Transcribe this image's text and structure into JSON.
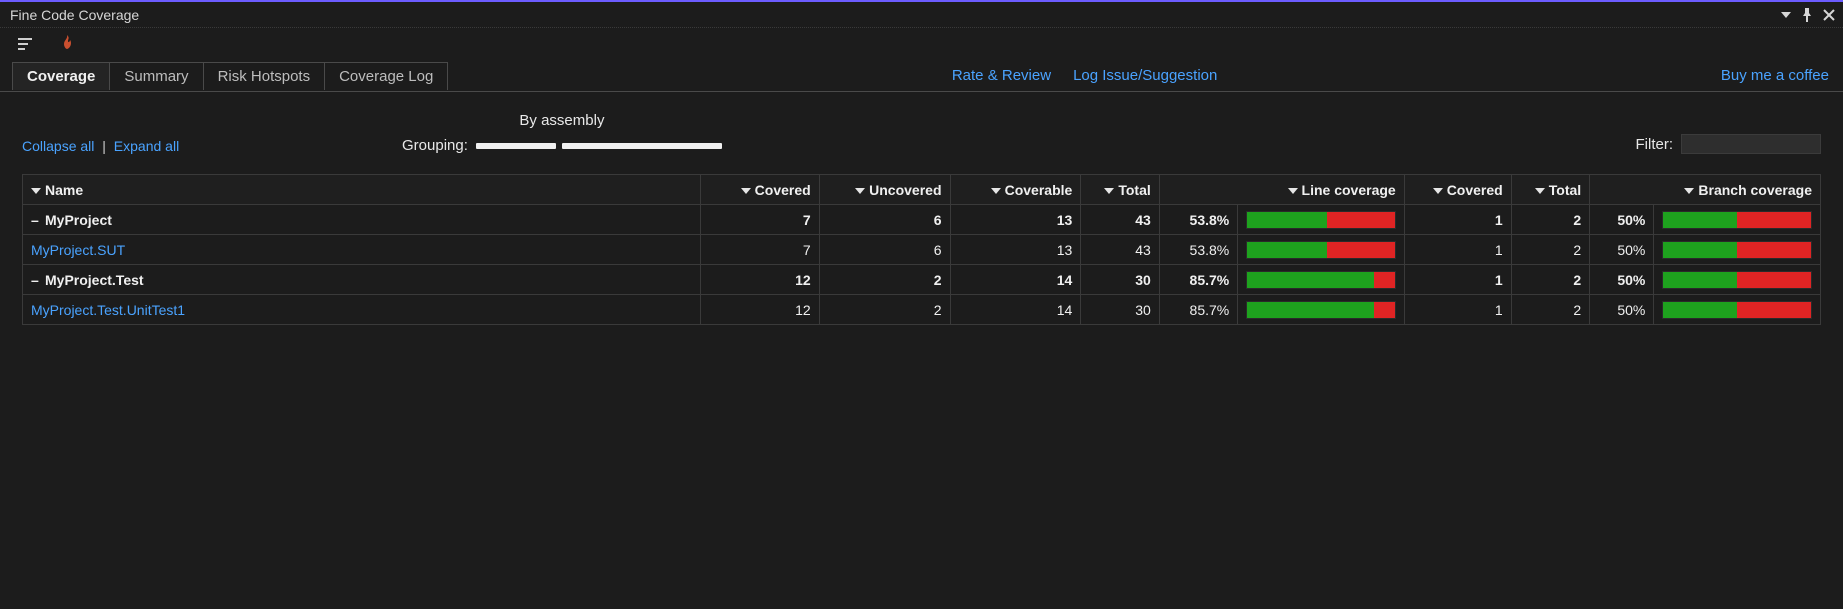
{
  "window": {
    "title": "Fine Code Coverage"
  },
  "toolbar_icons": {
    "coverage_view": "coverage-icon",
    "fire": "flame-icon"
  },
  "tabs": [
    {
      "label": "Coverage",
      "active": true
    },
    {
      "label": "Summary"
    },
    {
      "label": "Risk Hotspots"
    },
    {
      "label": "Coverage Log"
    }
  ],
  "links": {
    "rate_review": "Rate & Review",
    "log_issue": "Log Issue/Suggestion",
    "coffee": "Buy me a coffee"
  },
  "controls": {
    "collapse_all": "Collapse all",
    "expand_all": "Expand all",
    "grouping_label": "Grouping:",
    "grouping_title": "By assembly",
    "filter_label": "Filter:",
    "filter_value": ""
  },
  "columns": {
    "name": "Name",
    "covered": "Covered",
    "uncovered": "Uncovered",
    "coverable": "Coverable",
    "total": "Total",
    "line_coverage": "Line coverage",
    "b_covered": "Covered",
    "b_total": "Total",
    "branch_coverage": "Branch coverage"
  },
  "rows": [
    {
      "type": "group",
      "name": "MyProject",
      "covered": "7",
      "uncovered": "6",
      "coverable": "13",
      "total": "43",
      "line_pct": "53.8%",
      "line_val": 53.8,
      "b_covered": "1",
      "b_total": "2",
      "branch_pct": "50%",
      "branch_val": 50
    },
    {
      "type": "child",
      "name": "MyProject.SUT",
      "covered": "7",
      "uncovered": "6",
      "coverable": "13",
      "total": "43",
      "line_pct": "53.8%",
      "line_val": 53.8,
      "b_covered": "1",
      "b_total": "2",
      "branch_pct": "50%",
      "branch_val": 50
    },
    {
      "type": "group",
      "name": "MyProject.Test",
      "covered": "12",
      "uncovered": "2",
      "coverable": "14",
      "total": "30",
      "line_pct": "85.7%",
      "line_val": 85.7,
      "b_covered": "1",
      "b_total": "2",
      "branch_pct": "50%",
      "branch_val": 50
    },
    {
      "type": "child",
      "name": "MyProject.Test.UnitTest1",
      "covered": "12",
      "uncovered": "2",
      "coverable": "14",
      "total": "30",
      "line_pct": "85.7%",
      "line_val": 85.7,
      "b_covered": "1",
      "b_total": "2",
      "branch_pct": "50%",
      "branch_val": 50
    }
  ]
}
